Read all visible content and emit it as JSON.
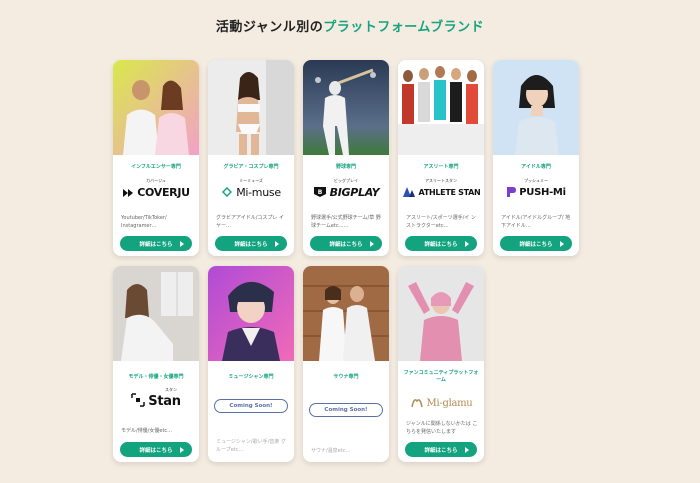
{
  "heading": {
    "prefix": "活動ジャンル別の",
    "accent": "プラットフォームブランド"
  },
  "colors": {
    "accent": "#14a37f",
    "background": "#f4ece1",
    "coming_soon": "#5b6fa8"
  },
  "cards": [
    {
      "genre": "インフルエンサー専門",
      "brand": "COVERJU",
      "ruby": "カバージュ",
      "icon": "coverju-logo-icon",
      "desc": "Youtuber/TikToker/ Instagramer…",
      "button": "詳細はこちら"
    },
    {
      "genre": "グラビア・コスプレ専門",
      "brand": "Mi-muse",
      "ruby": "ミーミューズ",
      "icon": "mimuse-logo-icon",
      "desc": "グラビアアイドル/コスプレ イヤー…",
      "button": "詳細はこちら"
    },
    {
      "genre": "野球専門",
      "brand": "BIGPLAY",
      "ruby": "ビッグプレイ",
      "icon": "bigplay-logo-icon",
      "desc": "野球選手/公式野球チーム/草 野球チームetc……",
      "button": "詳細はこちら"
    },
    {
      "genre": "アスリート専門",
      "brand": "ATHLETE STAN",
      "ruby": "アスリートスタン",
      "icon": "athlete-stan-logo-icon",
      "desc": "アスリート/スポーツ選手/イ ンストラクターetc…",
      "button": "詳細はこちら"
    },
    {
      "genre": "アイドル専門",
      "brand": "PUSH-Mi",
      "ruby": "プッシュミー",
      "icon": "pushmi-logo-icon",
      "desc": "アイドル/アイドルグループ/ 地下アイドル…",
      "button": "詳細はこちら"
    },
    {
      "genre": "モデル・俳優・女優専門",
      "brand": "Stan",
      "ruby": "スタン",
      "icon": "stan-logo-icon",
      "desc": "モデル/俳優/女優etc…",
      "button": "詳細はこちら"
    },
    {
      "genre": "ミュージシャン専門",
      "coming_soon": "Coming Soon!",
      "desc": "ミュージシャン/歌い手/音楽 グループetc…"
    },
    {
      "genre": "サウナ専門",
      "coming_soon": "Coming Soon!",
      "desc": "サウナ/温泉etc…"
    },
    {
      "genre": "ファンコミュニティプラットフォーム",
      "brand": "Mi-glamu",
      "icon": "miglamu-logo-icon",
      "desc": "ジャンルに関係しないかたは こちらを発信いたします",
      "button": "詳細はこちら"
    }
  ]
}
